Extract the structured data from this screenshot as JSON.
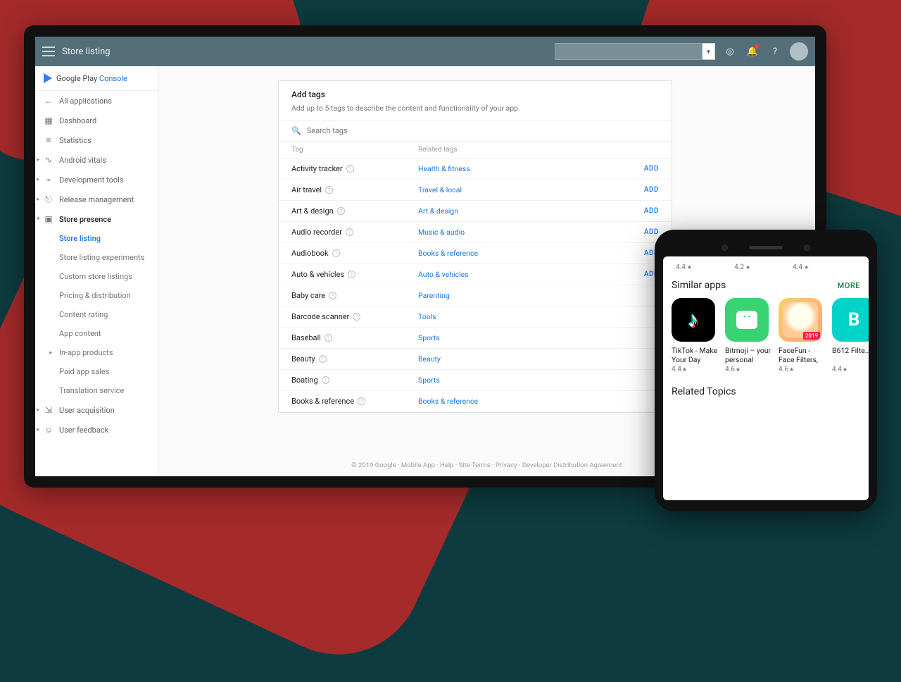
{
  "logo": {
    "text_a": "Google Play ",
    "text_b": "Console"
  },
  "topbar": {
    "title": "Store listing"
  },
  "nav": {
    "all_apps": "All applications",
    "dashboard": "Dashboard",
    "statistics": "Statistics",
    "vitals": "Android vitals",
    "dev_tools": "Development tools",
    "release": "Release management",
    "store_presence": "Store presence",
    "sub": {
      "listing": "Store listing",
      "experiments": "Store listing experiments",
      "custom": "Custom store listings",
      "pricing": "Pricing & distribution",
      "rating": "Content rating",
      "content": "App content",
      "inapp": "In-app products",
      "paid": "Paid app sales",
      "trans": "Translation service"
    },
    "acq": "User acquisition",
    "feedback": "User feedback"
  },
  "card": {
    "title": "Add tags",
    "subtitle": "Add up to 5 tags to describe the content and functionality of your app.",
    "search_ph": "Search tags",
    "th_tag": "Tag",
    "th_rel": "Related tags",
    "add": "ADD",
    "rows": [
      {
        "tag": "Activity tracker",
        "rel": "Health & fitness",
        "add": true
      },
      {
        "tag": "Air travel",
        "rel": "Travel & local",
        "add": true
      },
      {
        "tag": "Art & design",
        "rel": "Art & design",
        "add": true
      },
      {
        "tag": "Audio recorder",
        "rel": "Music & audio",
        "add": true
      },
      {
        "tag": "Audiobook",
        "rel": "Books & reference",
        "add": true
      },
      {
        "tag": "Auto & vehicles",
        "rel": "Auto & vehicles",
        "add": true
      },
      {
        "tag": "Baby care",
        "rel": "Parenting",
        "add": false
      },
      {
        "tag": "Barcode scanner",
        "rel": "Tools",
        "add": false
      },
      {
        "tag": "Baseball",
        "rel": "Sports",
        "add": false
      },
      {
        "tag": "Beauty",
        "rel": "Beauty",
        "add": false
      },
      {
        "tag": "Boating",
        "rel": "Sports",
        "add": false
      },
      {
        "tag": "Books & reference",
        "rel": "Books & reference",
        "add": false
      }
    ]
  },
  "footer": "© 2019 Google · Mobile App · Help · Site Terms · Privacy · Developer Distribution Agreement",
  "phone": {
    "prev_ratings": [
      "4.4",
      "4.2",
      "4.4"
    ],
    "similar": "Similar apps",
    "more": "MORE",
    "apps": [
      {
        "name": "TikTok - Make Your Day",
        "rate": "4.4"
      },
      {
        "name": "Bitmoji – your personal emoji",
        "rate": "4.6"
      },
      {
        "name": "FaceFun - Face Filters, Selfie E...",
        "rate": "4.6"
      },
      {
        "name": "B612 Filte...",
        "rate": "4.4"
      }
    ],
    "related": "Related Topics"
  }
}
